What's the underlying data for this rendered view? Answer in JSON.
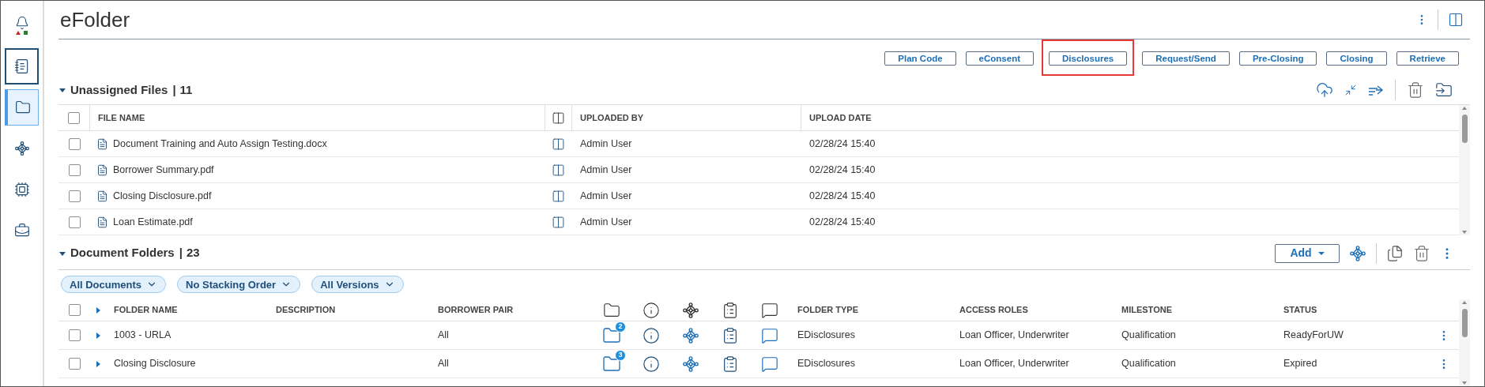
{
  "sidebar": {
    "items": [
      {
        "kind": "bell",
        "selected": false,
        "focused": false
      },
      {
        "kind": "list",
        "selected": false,
        "focused": true
      },
      {
        "kind": "folder",
        "selected": true,
        "focused": false
      },
      {
        "kind": "network",
        "selected": false,
        "focused": false
      },
      {
        "kind": "chip",
        "selected": false,
        "focused": false
      },
      {
        "kind": "briefcase",
        "selected": false,
        "focused": false
      }
    ]
  },
  "title": "eFolder",
  "action_buttons": [
    {
      "label": "Plan Code",
      "highlighted": false
    },
    {
      "label": "eConsent",
      "highlighted": false
    },
    {
      "label": "Disclosures",
      "highlighted": true
    },
    {
      "label": "Request/Send",
      "highlighted": false
    },
    {
      "label": "Pre-Closing",
      "highlighted": false
    },
    {
      "label": "Closing",
      "highlighted": false
    },
    {
      "label": "Retrieve",
      "highlighted": false
    }
  ],
  "unassigned": {
    "title": "Unassigned Files",
    "separator": "|",
    "count": "11",
    "expanded": true,
    "all_checked": false,
    "columns": [
      "FILE NAME",
      "UPLOADED BY",
      "UPLOAD DATE"
    ],
    "rows": [
      {
        "checked": false,
        "file_name": "Document Training and Auto Assign Testing.docx",
        "uploaded_by": "Admin User",
        "upload_date": "02/28/24 15:40"
      },
      {
        "checked": false,
        "file_name": "Borrower Summary.pdf",
        "uploaded_by": "Admin User",
        "upload_date": "02/28/24 15:40"
      },
      {
        "checked": false,
        "file_name": "Closing Disclosure.pdf",
        "uploaded_by": "Admin User",
        "upload_date": "02/28/24 15:40"
      },
      {
        "checked": false,
        "file_name": "Loan Estimate.pdf",
        "uploaded_by": "Admin User",
        "upload_date": "02/28/24 15:40"
      }
    ]
  },
  "folders": {
    "title": "Document Folders",
    "separator": "|",
    "count": "23",
    "expanded": true,
    "add_label": "Add",
    "all_checked": false,
    "filters": [
      "All Documents",
      "No Stacking Order",
      "All Versions"
    ],
    "columns": [
      "FOLDER NAME",
      "DESCRIPTION",
      "BORROWER PAIR",
      "FOLDER TYPE",
      "ACCESS ROLES",
      "MILESTONE",
      "STATUS"
    ],
    "rows": [
      {
        "checked": false,
        "expanded": false,
        "folder_name": "1003 - URLA",
        "borrower_pair": "All",
        "doc_count": "2",
        "folder_type": "EDisclosures",
        "access_roles": "Loan Officer, Underwriter",
        "milestone": "Qualification",
        "status": "ReadyForUW"
      },
      {
        "checked": false,
        "expanded": false,
        "folder_name": "Closing Disclosure",
        "borrower_pair": "All",
        "doc_count": "3",
        "folder_type": "EDisclosures",
        "access_roles": "Loan Officer, Underwriter",
        "milestone": "Qualification",
        "status": "Expired"
      }
    ]
  }
}
